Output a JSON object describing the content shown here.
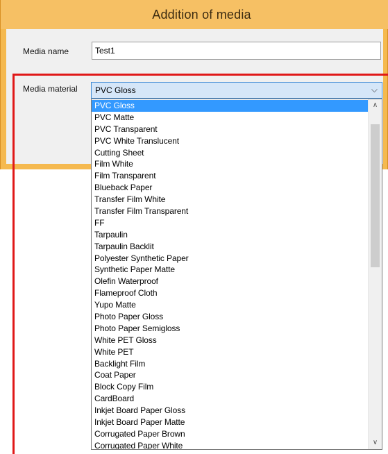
{
  "window": {
    "title": "Addition of media"
  },
  "form": {
    "media_name_label": "Media name",
    "media_name_value": "Test1",
    "media_material_label": "Media material",
    "media_material_selected": "PVC Gloss"
  },
  "dropdown": {
    "items": [
      "PVC Gloss",
      "PVC Matte",
      "PVC Transparent",
      "PVC White Translucent",
      "Cutting Sheet",
      "Film White",
      "Film Transparent",
      "Blueback Paper",
      "Transfer Film White",
      "Transfer Film Transparent",
      "FF",
      "Tarpaulin",
      "Tarpaulin Backlit",
      "Polyester Synthetic Paper",
      "Synthetic Paper Matte",
      "Olefin Waterproof",
      "Flameproof Cloth",
      "Yupo Matte",
      "Photo Paper Gloss",
      "Photo Paper Semigloss",
      "White PET Gloss",
      "White PET",
      "Backlight Film",
      "Coat Paper",
      "Block Copy Film",
      "CardBoard",
      "Inkjet Board Paper Gloss",
      "Inkjet Board Paper Matte",
      "Corrugated Paper Brown",
      "Corrugated Paper White"
    ],
    "selected_index": 0
  },
  "icons": {
    "select_arrow": "chevron-down-icon",
    "scroll_up": "chevron-up-icon",
    "scroll_down": "chevron-down-icon"
  },
  "colors": {
    "title_bar": "#f6c064",
    "selection": "#3399ff",
    "highlight_border": "#e01818"
  }
}
